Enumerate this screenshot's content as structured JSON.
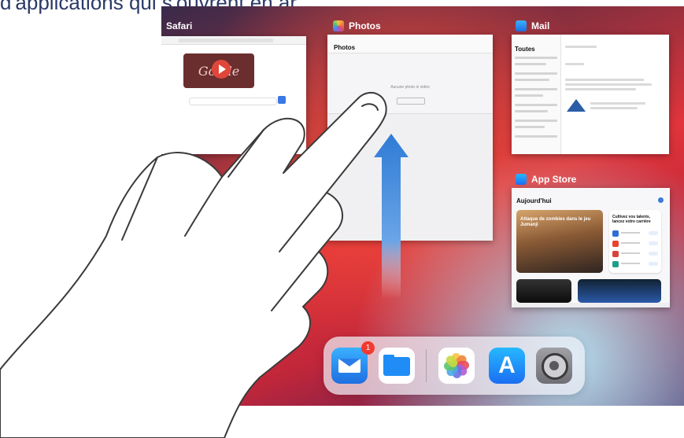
{
  "caption": "d'applications qui s'ouvrent en ar",
  "app_switcher": {
    "safari": {
      "title": "Safari",
      "icon": "compass-icon",
      "doodle_text": "Go gle"
    },
    "photos": {
      "title": "Photos",
      "header": "Photos",
      "empty_text": "Aucune photo ni vidéo",
      "icon": "photos-icon"
    },
    "mail": {
      "title": "Mail",
      "list_title": "Toutes",
      "icon": "envelope-icon"
    },
    "app_store": {
      "title": "App Store",
      "header": "Aujourd'hui",
      "feature_text": "Attaque de zombies dans le jeu Jumanji",
      "list_title": "Cultivez vos talents, lancez votre carrière",
      "icon": "app-store-icon"
    }
  },
  "dock": {
    "apps": [
      "Mail",
      "Files",
      "Photos",
      "App Store",
      "Settings"
    ],
    "mail_badge": "1"
  },
  "colors": {
    "accent": "#1f6fe0",
    "badge": "#f23a30",
    "arrow": "#2f7bd6"
  }
}
